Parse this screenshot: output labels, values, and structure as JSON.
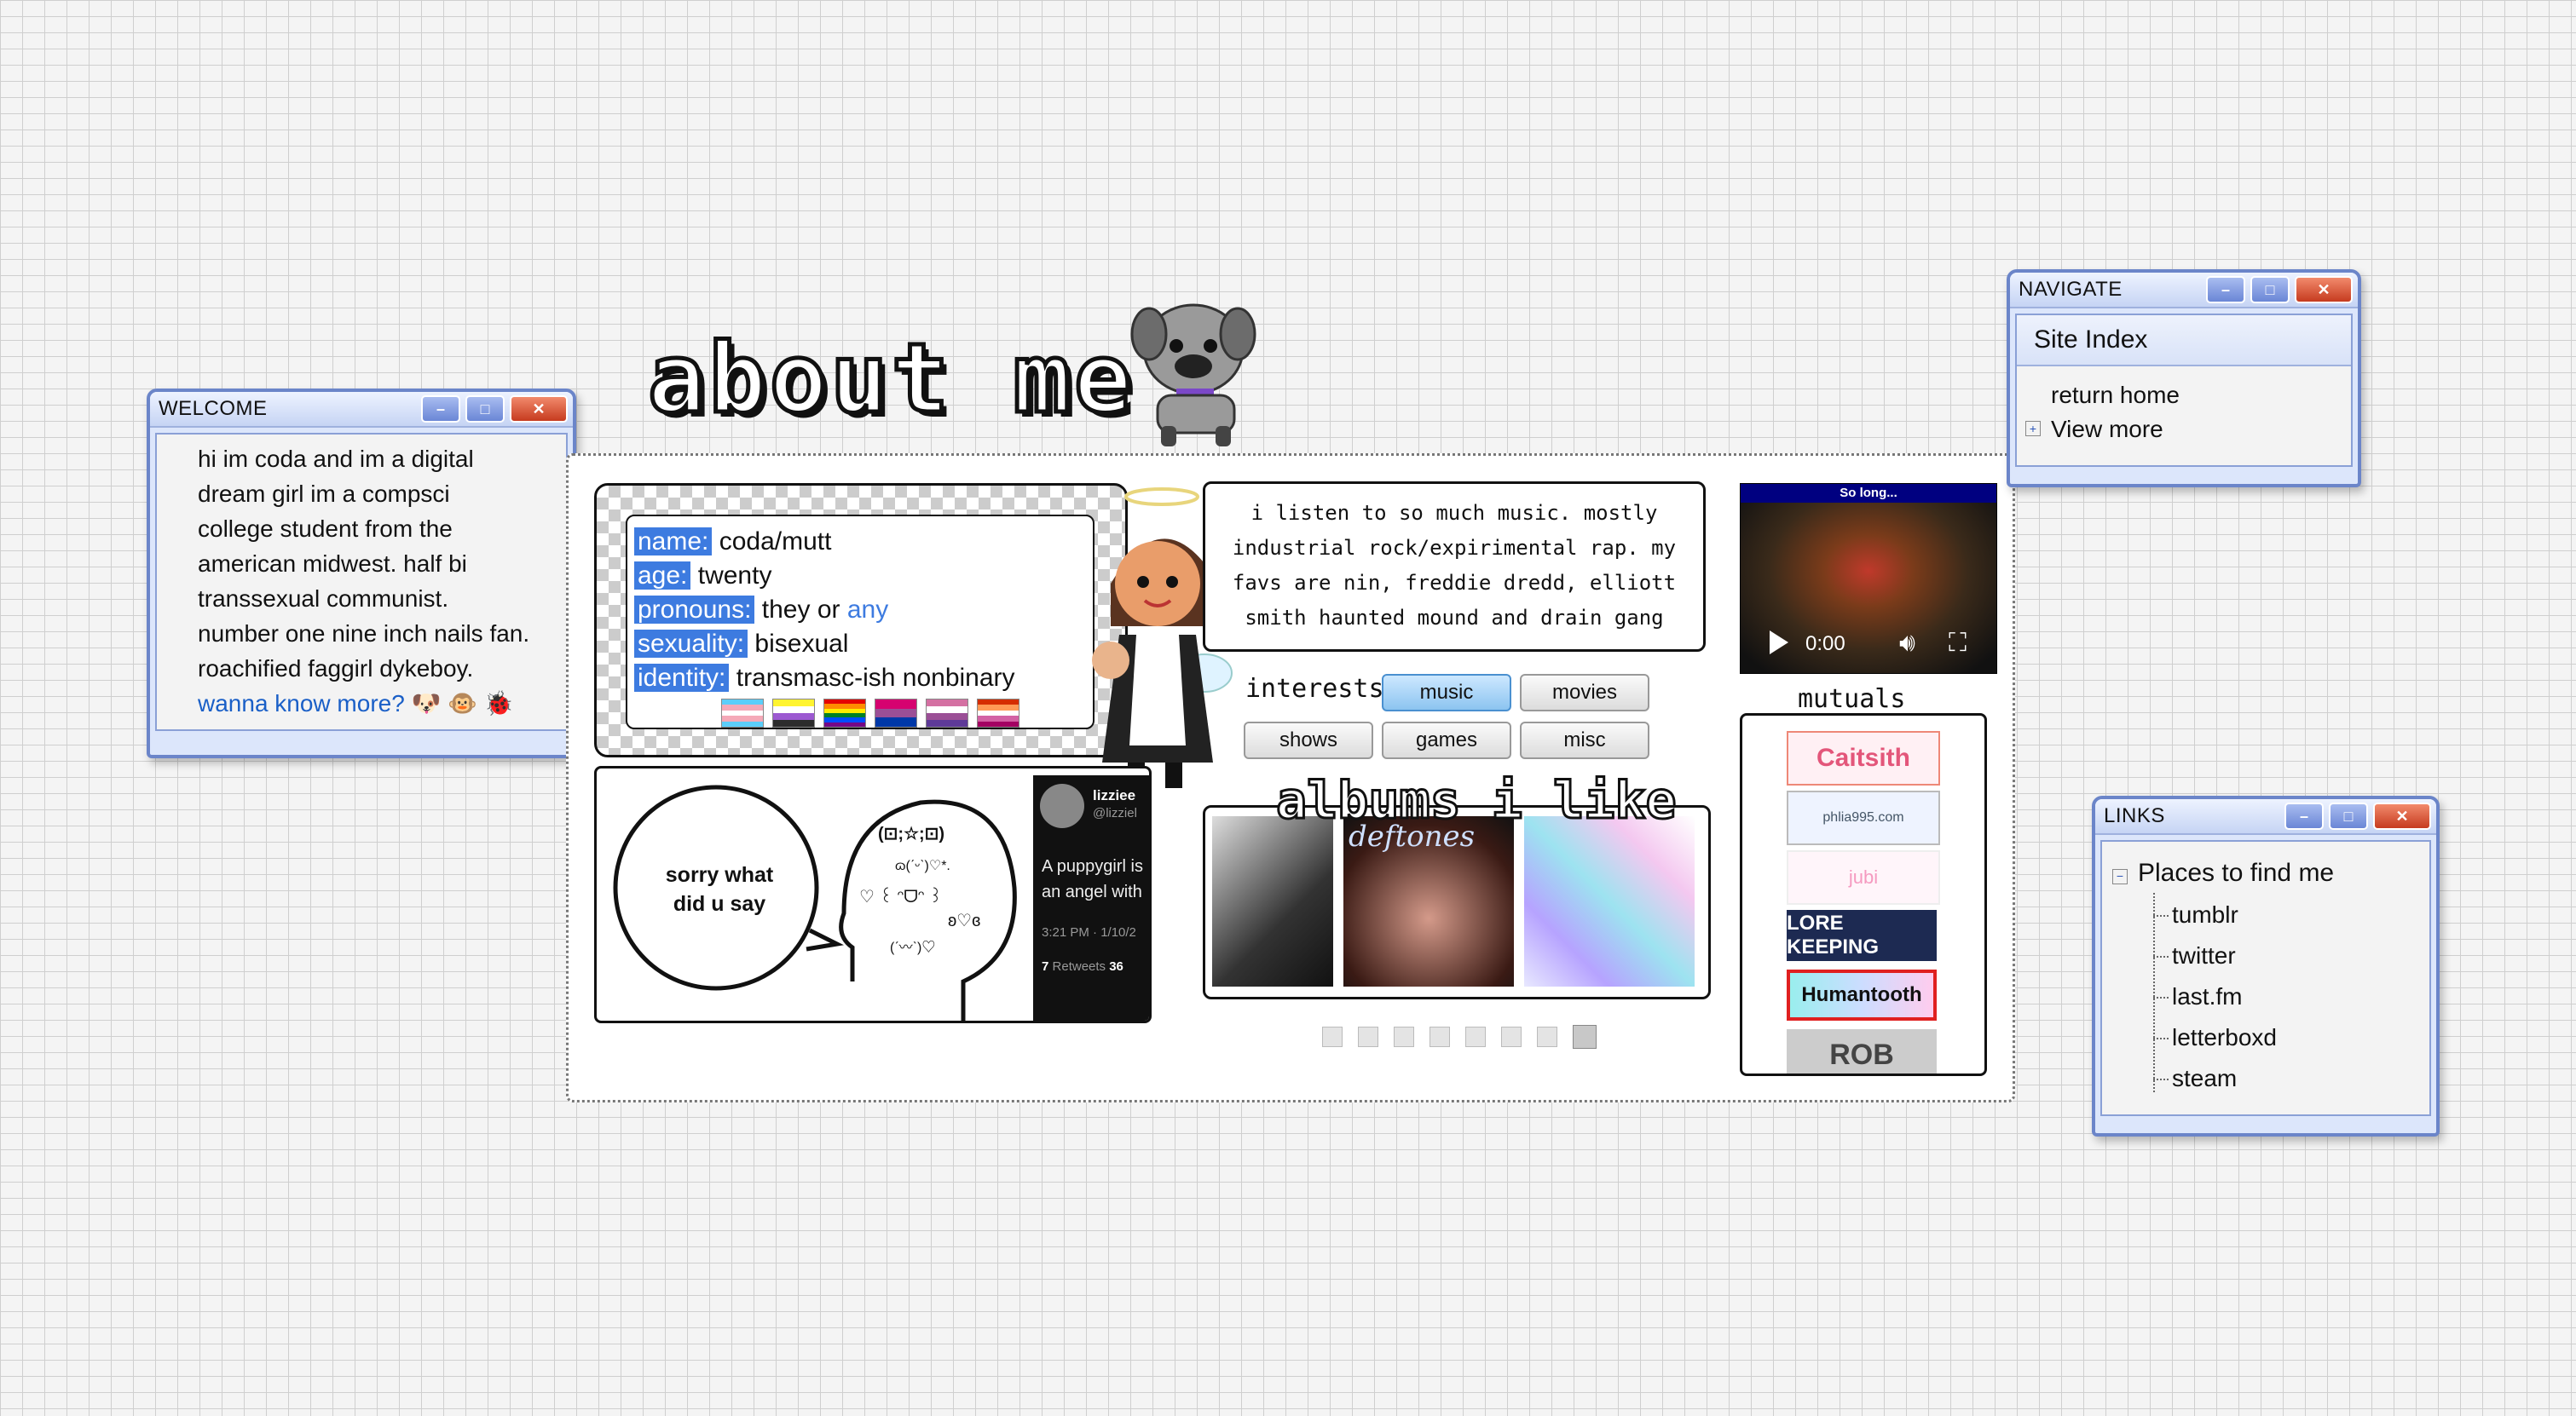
{
  "welcome": {
    "title": "WELCOME",
    "lines": [
      "hi im coda and im a digital",
      "dream girl im a compsci",
      "college student from the",
      "american midwest. half bi",
      "transsexual communist.",
      "number one nine inch nails fan.",
      "roachified faggirl dykeboy."
    ],
    "link": "wanna know more?",
    "link_icons": [
      "🐶",
      "🐵",
      "🐞"
    ]
  },
  "heading": "about me",
  "profile": {
    "rows": [
      {
        "label": "name:",
        "value": "coda/mutt"
      },
      {
        "label": "age:",
        "value": "twenty"
      },
      {
        "label": "pronouns:",
        "value": "they or ",
        "extra": "any"
      },
      {
        "label": "sexuality:",
        "value": "bisexual"
      },
      {
        "label": "identity:",
        "value": "transmasc-ish nonbinary"
      }
    ],
    "flag_colors": [
      [
        "#5bcefa",
        "#f5a9b8",
        "#ffffff",
        "#f5a9b8",
        "#5bcefa"
      ],
      [
        "#fff430",
        "#ffffff",
        "#9c59d1",
        "#2c2c2c"
      ],
      [
        "#e40303",
        "#ff8c00",
        "#ffed00",
        "#008026",
        "#004dff",
        "#750787"
      ],
      [
        "#d60270",
        "#9b4f96",
        "#0038a8"
      ],
      [
        "#d470a2",
        "#ffffff",
        "#9b4f96",
        "#5e3a98"
      ],
      [
        "#d52d00",
        "#ff9a56",
        "#ffffff",
        "#d362a4",
        "#a30262"
      ]
    ]
  },
  "meme": {
    "bubble": "sorry what did u say",
    "kaomoji": [
      "(⊡;☆;⊡)",
      "ɷ(ˊᵕˋ)♡*.",
      "♡ ꒰ ᵔᗜᵔ ꒱",
      "ʚ♡ɞ",
      "(ˊ〰ˋ)♡"
    ],
    "tweet_name": "lizziee",
    "tweet_handle": "@lizziel",
    "tweet_text": "A puppygirl is an angel with",
    "tweet_time": "3:21 PM · 1/10/2",
    "tweet_rt_count": "7",
    "tweet_rt_label": "Retweets",
    "tweet_likes": "36"
  },
  "music": {
    "text": "i listen to so much music. mostly industrial rock/expirimental rap. my favs are nin, freddie dredd, elliott smith haunted mound and drain gang"
  },
  "interests": {
    "label": "interests:",
    "buttons": [
      "music",
      "movies",
      "shows",
      "games",
      "misc"
    ],
    "active": "music"
  },
  "albums": {
    "heading": "albums i like",
    "covers": [
      {
        "name": "album-cover-1",
        "text": ""
      },
      {
        "name": "album-cover-deftones",
        "text": "deftones"
      },
      {
        "name": "album-cover-3",
        "text": ""
      }
    ]
  },
  "video": {
    "title": "So long...",
    "time": "0:00"
  },
  "mutuals": {
    "heading": "mutuals",
    "buttons": [
      "Caitsith",
      "phlia995.com",
      "jubi",
      "LORE KEEPING",
      "Humantooth",
      "ROB"
    ]
  },
  "navigate": {
    "title": "NAVIGATE",
    "header": "Site Index",
    "items": [
      "return home",
      "View more"
    ]
  },
  "links": {
    "title": "LINKS",
    "root": "Places to find me",
    "items": [
      "tumblr",
      "twitter",
      "last.fm",
      "letterboxd",
      "steam"
    ]
  },
  "colors": {
    "accent": "#3d7be0",
    "link": "#1a5fc7",
    "window_border": "#6b85c9"
  }
}
